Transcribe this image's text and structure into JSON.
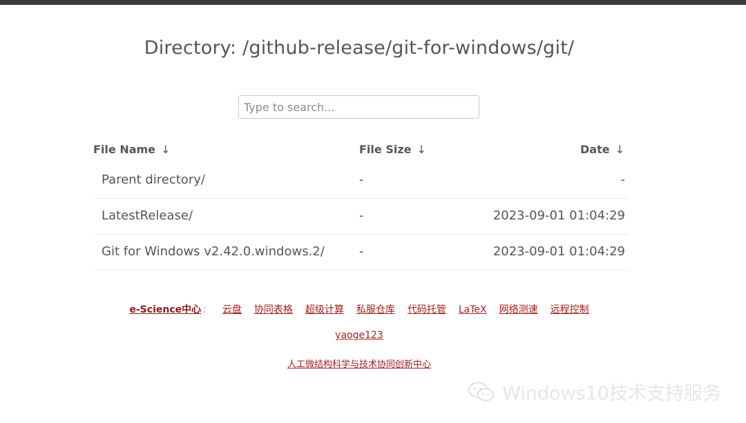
{
  "page": {
    "title": "Directory: /github-release/git-for-windows/git/"
  },
  "search": {
    "placeholder": "Type to search..."
  },
  "table": {
    "headers": {
      "name": "File Name",
      "size": "File Size",
      "date": "Date",
      "sort_glyph": "↓"
    },
    "rows": [
      {
        "name": "Parent directory/",
        "size": "-",
        "date": "-"
      },
      {
        "name": "LatestRelease/",
        "size": "-",
        "date": "2023-09-01 01:04:29"
      },
      {
        "name": "Git for Windows v2.42.0.windows.2/",
        "size": "-",
        "date": "2023-09-01 01:04:29"
      }
    ]
  },
  "footer": {
    "brand": "e-Science中心",
    "brand_sep": ":",
    "links": [
      "云盘",
      "协同表格",
      "超级计算",
      "私服仓库",
      "代码托管",
      "LaTeX",
      "网络测速",
      "远程控制"
    ],
    "user": "yaoge123",
    "org": "人工微结构科学与技术协同创新中心"
  },
  "watermark": {
    "text": "Windows10技术支持服务",
    "icon": "wechat-icon"
  },
  "colors": {
    "link": "#a31f1f",
    "text": "#555555",
    "top_bar": "#3b3b3b"
  }
}
